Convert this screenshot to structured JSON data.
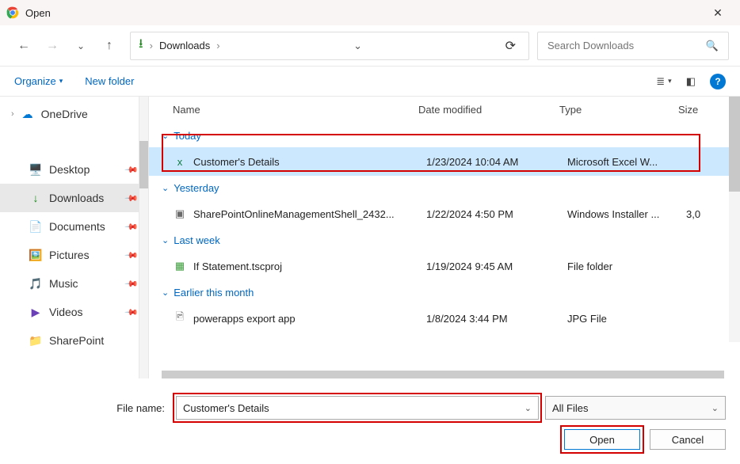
{
  "title": "Open",
  "breadcrumb": "Downloads",
  "search_placeholder": "Search Downloads",
  "toolbar": {
    "organize": "Organize",
    "newfolder": "New folder"
  },
  "sidebar": {
    "onedrive": "OneDrive",
    "items": [
      {
        "label": "Desktop",
        "icon": "🖥️",
        "color": "#3aa5e6"
      },
      {
        "label": "Downloads",
        "icon": "↓",
        "color": "#1a8a1a"
      },
      {
        "label": "Documents",
        "icon": "📄",
        "color": "#3aa5e6"
      },
      {
        "label": "Pictures",
        "icon": "🖼️",
        "color": "#2d7ad6"
      },
      {
        "label": "Music",
        "icon": "🎵",
        "color": "#e34b7a"
      },
      {
        "label": "Videos",
        "icon": "▶",
        "color": "#6b3fb5"
      },
      {
        "label": "SharePoint",
        "icon": "📁",
        "color": "#f2c14e"
      }
    ]
  },
  "columns": {
    "name": "Name",
    "date": "Date modified",
    "type": "Type",
    "size": "Size"
  },
  "groups": [
    {
      "label": "Today",
      "files": [
        {
          "name": "Customer's Details",
          "date": "1/23/2024 10:04 AM",
          "type": "Microsoft Excel W...",
          "size": "",
          "icon": "x",
          "iconcolor": "#107c41",
          "selected": true
        }
      ]
    },
    {
      "label": "Yesterday",
      "files": [
        {
          "name": "SharePointOnlineManagementShell_2432...",
          "date": "1/22/2024 4:50 PM",
          "type": "Windows Installer ...",
          "size": "3,0",
          "icon": "▣",
          "iconcolor": "#6a6a6a"
        }
      ]
    },
    {
      "label": "Last week",
      "files": [
        {
          "name": "If Statement.tscproj",
          "date": "1/19/2024 9:45 AM",
          "type": "File folder",
          "size": "",
          "icon": "▦",
          "iconcolor": "#3c9b3c"
        }
      ]
    },
    {
      "label": "Earlier this month",
      "files": [
        {
          "name": "powerapps export app",
          "date": "1/8/2024 3:44 PM",
          "type": "JPG File",
          "size": "",
          "icon": "🖻",
          "iconcolor": "#888"
        }
      ]
    }
  ],
  "filename_label": "File name:",
  "filename_value": "Customer's Details",
  "filter_value": "All Files",
  "buttons": {
    "open": "Open",
    "cancel": "Cancel"
  }
}
